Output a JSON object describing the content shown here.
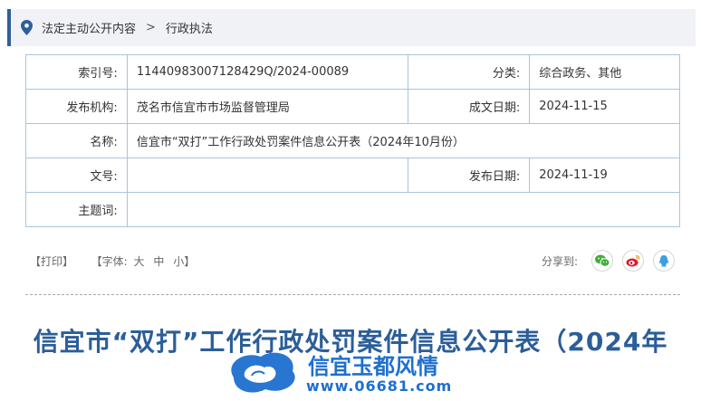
{
  "breadcrumb": {
    "items": [
      "法定主动公开内容",
      "行政执法"
    ],
    "separator": ">"
  },
  "meta": {
    "index_label": "索引号:",
    "index_value": "11440983007128429Q/2024-00089",
    "category_label": "分类:",
    "category_value": "综合政务、其他",
    "publisher_label": "发布机构:",
    "publisher_value": "茂名市信宜市市场监督管理局",
    "created_label": "成文日期:",
    "created_value": "2024-11-15",
    "name_label": "名称:",
    "name_value": "信宜市“双打”工作行政处罚案件信息公开表（2024年10月份）",
    "docno_label": "文号:",
    "docno_value": "",
    "published_label": "发布日期:",
    "published_value": "2024-11-19",
    "subject_label": "主题词:",
    "subject_value": ""
  },
  "toolbar": {
    "print": "【打印】",
    "font_open": "【字体:",
    "font_large": "大",
    "font_medium": "中",
    "font_small": "小】"
  },
  "share": {
    "label": "分享到:",
    "icons": [
      "wechat-icon",
      "weibo-icon",
      "qq-icon"
    ],
    "colors": {
      "wechat": "#3cb034",
      "weibo": "#e6162d",
      "qq": "#3aa0e0"
    }
  },
  "article": {
    "title": "信宜市“双打”工作行政处罚案件信息公开表（2024年"
  },
  "watermark": {
    "text": "信宜玉都风情",
    "url": "www.06681.com"
  },
  "colors": {
    "accent": "#2f5f9a",
    "title": "#2c5e98",
    "border": "#aac3dd"
  }
}
